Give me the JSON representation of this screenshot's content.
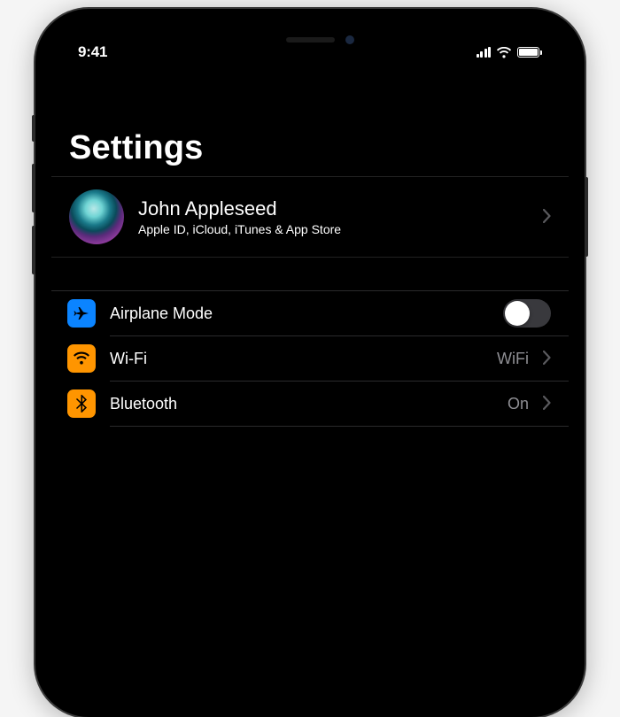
{
  "status": {
    "time": "9:41"
  },
  "page": {
    "title": "Settings"
  },
  "account": {
    "name": "John Appleseed",
    "subtitle": "Apple ID, iCloud, iTunes & App Store"
  },
  "rows": {
    "airplane": {
      "label": "Airplane Mode",
      "toggle": "off"
    },
    "wifi": {
      "label": "Wi-Fi",
      "value": "WiFi"
    },
    "bluetooth": {
      "label": "Bluetooth",
      "value": "On"
    }
  }
}
